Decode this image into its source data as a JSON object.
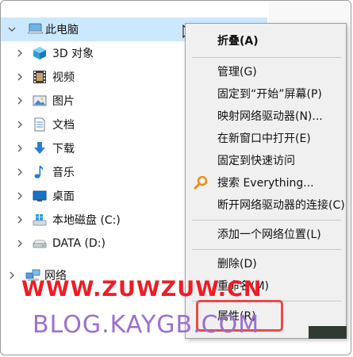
{
  "tree": {
    "items": [
      {
        "label": "此电脑",
        "icon": "computer-icon"
      },
      {
        "label": "3D 对象",
        "icon": "3d-objects-icon"
      },
      {
        "label": "视频",
        "icon": "video-icon"
      },
      {
        "label": "图片",
        "icon": "pictures-icon"
      },
      {
        "label": "文档",
        "icon": "documents-icon"
      },
      {
        "label": "下载",
        "icon": "download-icon"
      },
      {
        "label": "音乐",
        "icon": "music-icon"
      },
      {
        "label": "桌面",
        "icon": "desktop-icon"
      },
      {
        "label": "本地磁盘 (C:)",
        "icon": "windows-drive-icon"
      },
      {
        "label": "DATA (D:)",
        "icon": "drive-icon"
      },
      {
        "label": "网络",
        "icon": "network-icon"
      }
    ]
  },
  "context_menu": {
    "items": [
      {
        "label": "折叠(A)",
        "bold": true
      },
      {
        "label": "管理(G)"
      },
      {
        "label": "固定到“开始”屏幕(P)"
      },
      {
        "label": "映射网络驱动器(N)..."
      },
      {
        "label": "在新窗口中打开(E)"
      },
      {
        "label": "固定到快速访问"
      },
      {
        "label": "搜索 Everything...",
        "icon": "search-everything-icon"
      },
      {
        "label": "断开网络驱动器的连接(C)"
      },
      {
        "label": "添加一个网络位置(L)"
      },
      {
        "label": "删除(D)"
      },
      {
        "label": "重命名(M)"
      },
      {
        "label": "属性(R)"
      }
    ]
  },
  "watermark": {
    "line1": "WWW.ZUWZUW.CN",
    "line2": "BLOG.KAYGB.COM"
  },
  "colors": {
    "selection": "#cce8ff",
    "menu_bg": "#f0f0f0",
    "watermark_red": "#ee1c25",
    "watermark_purple": "#9b6fd2",
    "highlight_box": "#e84a4a"
  }
}
